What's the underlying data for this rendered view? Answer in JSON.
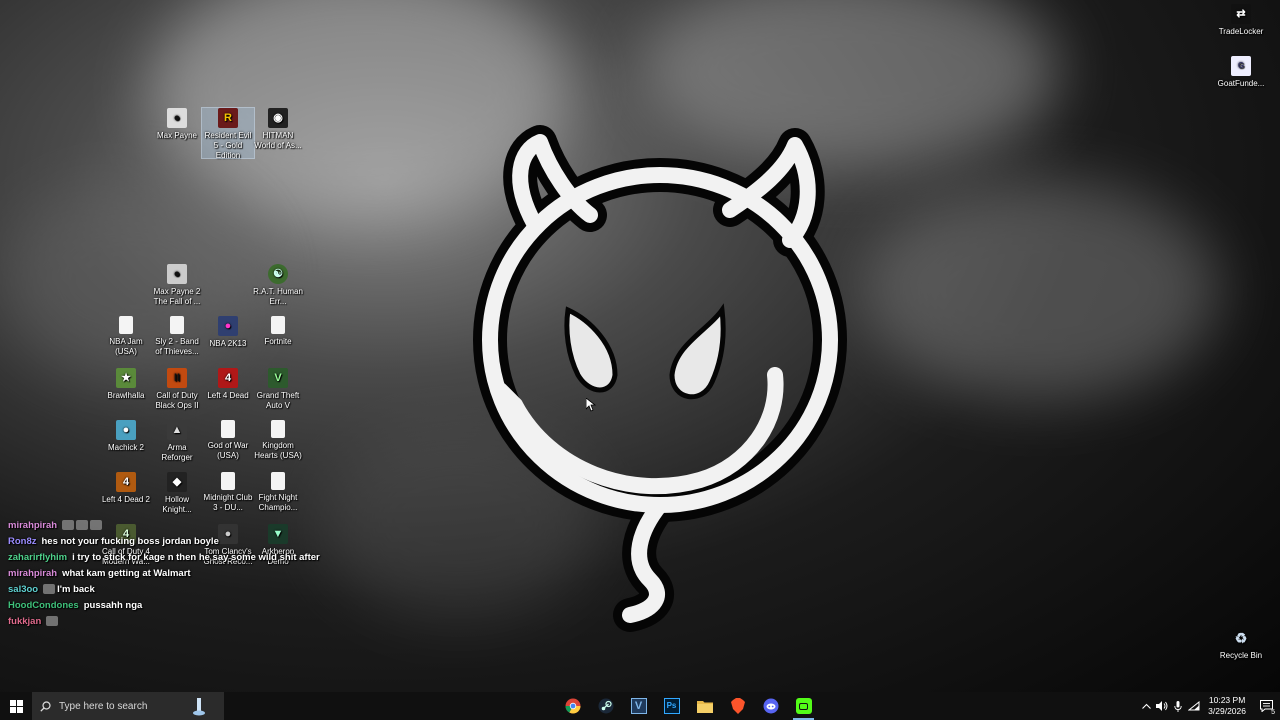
{
  "desktop_icons": {
    "max_payne": "Max Payne",
    "resident_evil": "Resident Evil 5 - Gold Edition",
    "hitman": "HITMAN World of As...",
    "max_payne_2": "Max Payne 2 The Fall of ...",
    "rat": "R.A.T. Human Err...",
    "nba_jam": "NBA Jam (USA)",
    "sly_2": "Sly 2 - Band of Thieves...",
    "nba_2k13": "NBA 2K13",
    "fortnite": "Fortnite",
    "brawlhalla": "Brawlhalla",
    "cod_bo2": "Call of Duty Black Ops II",
    "l4d": "Left 4 Dead",
    "gta5": "Grand Theft Auto V",
    "machick": "Machick 2",
    "arma": "Arma Reforger",
    "gow": "God of War (USA)",
    "kh": "Kingdom Hearts (USA)",
    "l4d2": "Left 4 Dead 2",
    "hollow": "Hollow Knight...",
    "midnight": "Midnight Club 3 - DU...",
    "fight_night": "Fight Night Champio...",
    "cod4": "Call of Duty 4 Modern Wa...",
    "tom_clancy": "Tom Clancy's Ghost Reco...",
    "arkheron": "Arkheron Demo",
    "tradelocker": "TradeLocker",
    "goatfunded": "GoatFunde...",
    "recycle": "Recycle Bin"
  },
  "chat": [
    {
      "user": "mirahpirah",
      "color": "#d98bd9",
      "msg": "",
      "emotes": 3
    },
    {
      "user": "Ron8z",
      "color": "#9b8cff",
      "msg": "hes not your fucking boss jordan boyle",
      "emotes": 0
    },
    {
      "user": "zaharirflyhim",
      "color": "#4fd18b",
      "msg": "i try to stick for kage n then he say some wild shit after",
      "emotes": 0
    },
    {
      "user": "mirahpirah",
      "color": "#d98bd9",
      "msg": "what kam getting at Walmart",
      "emotes": 0
    },
    {
      "user": "sal3oo",
      "color": "#5fd0d0",
      "msg": "I'm back",
      "emotes": 1
    },
    {
      "user": "HoodCondones",
      "color": "#3fc07a",
      "msg": "pussahh nga",
      "emotes": 0
    },
    {
      "user": "fukkjan",
      "color": "#e06a8c",
      "msg": "",
      "emotes": 1
    }
  ],
  "taskbar": {
    "search_placeholder": "Type here to search",
    "time": "10:23 PM",
    "date": "3/29/2026",
    "notification_count": "5"
  },
  "colors": {
    "taskbar_bg": "#101010",
    "search_bg": "#2b2b2b",
    "active_indicator": "#7fb6e8"
  }
}
